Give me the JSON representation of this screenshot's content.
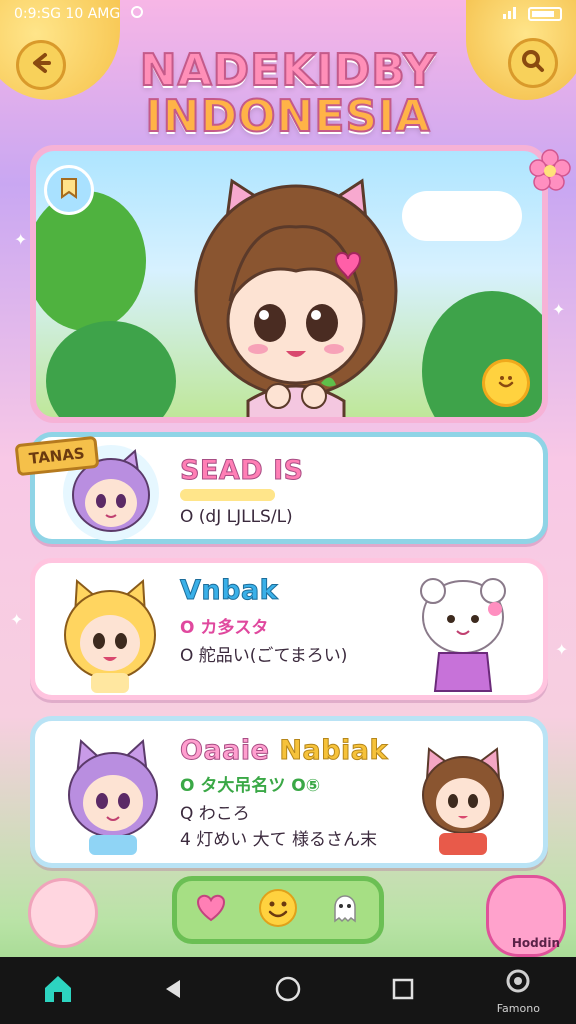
{
  "status_bar": {
    "time": "0:9:SG 10 AMG",
    "battery": "battery"
  },
  "title": {
    "line1": "NADEKIDBY",
    "line2": "INDONESIA"
  },
  "hero": {
    "icon_left": "bookmark-icon",
    "icon_right": "smile-icon"
  },
  "ribbon": {
    "label": "TANAS"
  },
  "cards": [
    {
      "title": "SEAD IS",
      "line1": "O (dJ LJLLS/L)"
    },
    {
      "title": "Vnbak",
      "line1": "O カ多スタ",
      "line2": "O 舵品い(ごてまろい)"
    },
    {
      "title_a": "Oaaie",
      "title_b": "Nabiak",
      "line1": "O タ大吊名ツ O⑤",
      "line2": "Q わころ",
      "line3": "4 灯めい 大て 様るさん末"
    }
  ],
  "corner_label": "Hoddin",
  "nav": {
    "recorder_label": "Famono"
  },
  "colors": {
    "accent_pink": "#ff7fb5",
    "accent_blue": "#3ab0e8",
    "accent_yellow": "#ffd54a",
    "accent_green": "#6bbf54"
  }
}
